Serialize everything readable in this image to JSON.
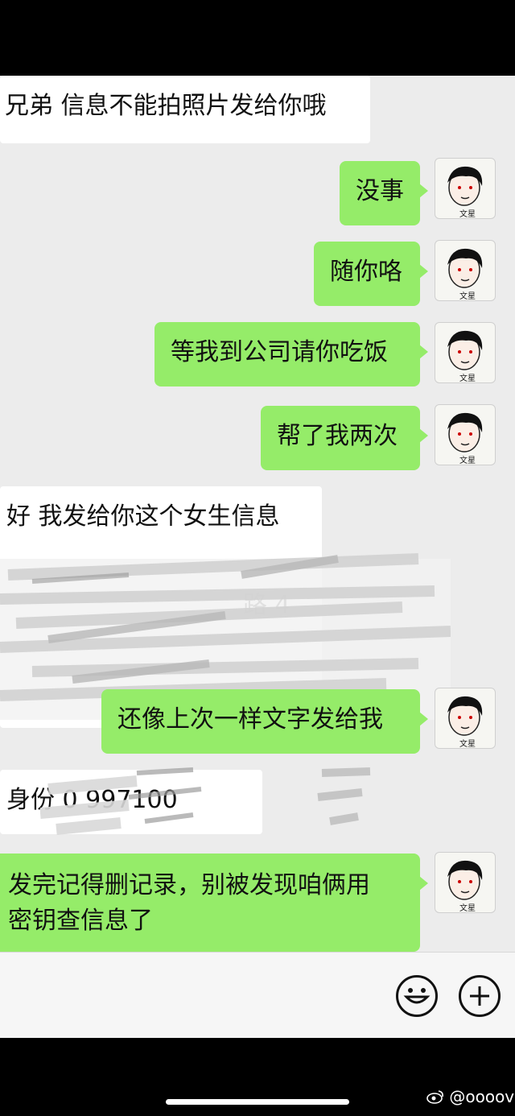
{
  "messages": [
    {
      "side": "incoming",
      "text": "兄弟 信息不能拍照片发给你哦"
    },
    {
      "side": "outgoing",
      "text": "没事"
    },
    {
      "side": "outgoing",
      "text": "随你咯"
    },
    {
      "side": "outgoing",
      "text": "等我到公司请你吃饭"
    },
    {
      "side": "outgoing",
      "text": "帮了我两次"
    },
    {
      "side": "incoming",
      "text": "好 我发给你这个女生信息"
    },
    {
      "side": "incoming",
      "text": "路 4"
    },
    {
      "side": "outgoing",
      "text": "还像上次一样文字发给我"
    },
    {
      "side": "incoming",
      "text": "身份 0 997100"
    },
    {
      "side": "outgoing",
      "lines": [
        "发完记得删记录，别被发现咱俩用",
        "密钥查信息了"
      ]
    }
  ],
  "avatar": {
    "caption": "文星"
  },
  "input_bar": {
    "emoji_icon": "smiley-icon",
    "more_icon": "plus-circle-icon"
  },
  "watermark": {
    "text": "@ooooviki",
    "icon": "weibo-icon"
  },
  "colors": {
    "outgoing_bubble": "#95ec69",
    "incoming_bubble": "#ffffff",
    "chat_bg": "#ececec"
  }
}
